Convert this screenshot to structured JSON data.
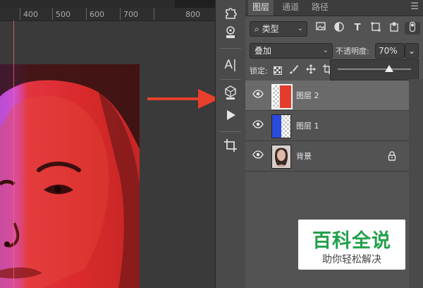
{
  "ruler": {
    "ticks": [
      "400",
      "500",
      "600",
      "700",
      "800"
    ]
  },
  "toolbar": {
    "tools": [
      "puzzle-icon",
      "stamp-icon",
      "text-type-icon",
      "3d-cube-icon",
      "play-icon",
      "crop-icon"
    ],
    "type_glyph": "A|"
  },
  "panel": {
    "tabs": [
      "图层",
      "通道",
      "路径"
    ],
    "active_tab": "图层",
    "filter": {
      "label": "类型"
    },
    "blend_mode": "叠加",
    "opacity_label": "不透明度:",
    "opacity_value": "70%",
    "lock_label": "锁定:",
    "opacity_slider_fraction": 0.7
  },
  "layers": [
    {
      "name": "图层 2",
      "selected": true,
      "thumb_color": "#e33b2c"
    },
    {
      "name": "图层 1",
      "selected": false,
      "thumb_color": "#2a4bdc"
    },
    {
      "name": "背景",
      "selected": false,
      "locked": true
    }
  ],
  "watermark": {
    "title": "百科全说",
    "subtitle": "助你轻松解决"
  },
  "colors": {
    "arrow": "#e8402a",
    "accent_green": "#23a04b"
  }
}
